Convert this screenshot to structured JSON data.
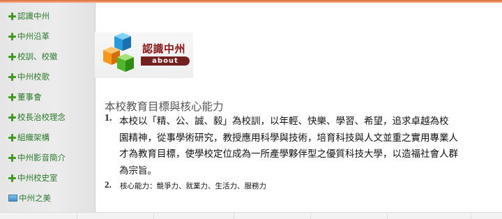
{
  "sidebar": {
    "items": [
      {
        "label": "認識中州",
        "icon": "plus-icon"
      },
      {
        "label": "中州沿革",
        "icon": "plus-icon"
      },
      {
        "label": "校訓、校徽",
        "icon": "plus-icon"
      },
      {
        "label": "中州校歌",
        "icon": "plus-icon"
      },
      {
        "label": "董事會",
        "icon": "plus-icon"
      },
      {
        "label": "校長治校理念",
        "icon": "plus-icon"
      },
      {
        "label": "組織架構",
        "icon": "plus-icon"
      },
      {
        "label": "中州影音簡介",
        "icon": "plus-icon"
      },
      {
        "label": "中州校史室",
        "icon": "plus-icon"
      },
      {
        "label": "中州之美",
        "icon": "image-icon"
      }
    ]
  },
  "banner": {
    "title": "認識中州",
    "badge": "about"
  },
  "content": {
    "heading": "本校教育目標與核心能力",
    "item1": {
      "number": "1.",
      "lines": [
        "本校以「精、公、誠、毅」為校訓，以年輕、快樂、學習、希望，追求卓越為校",
        "園精神，從事學術研究，教授應用科學與技術，培育科技與人文並重之實用專業人",
        "才為教育目標，使學校定位成為一所產學夥伴型之優質科技大學，以造福社會人群",
        "為宗旨。"
      ]
    },
    "item2": {
      "number": "2.",
      "text": "核心能力：競爭力、就業力、生活力、服務力"
    }
  },
  "colors": {
    "accent_top_bar": "#e06a36",
    "sidebar_link": "#2d7a2d",
    "plus_icon": "#3f9a1f",
    "banner_title": "#8a1717"
  }
}
